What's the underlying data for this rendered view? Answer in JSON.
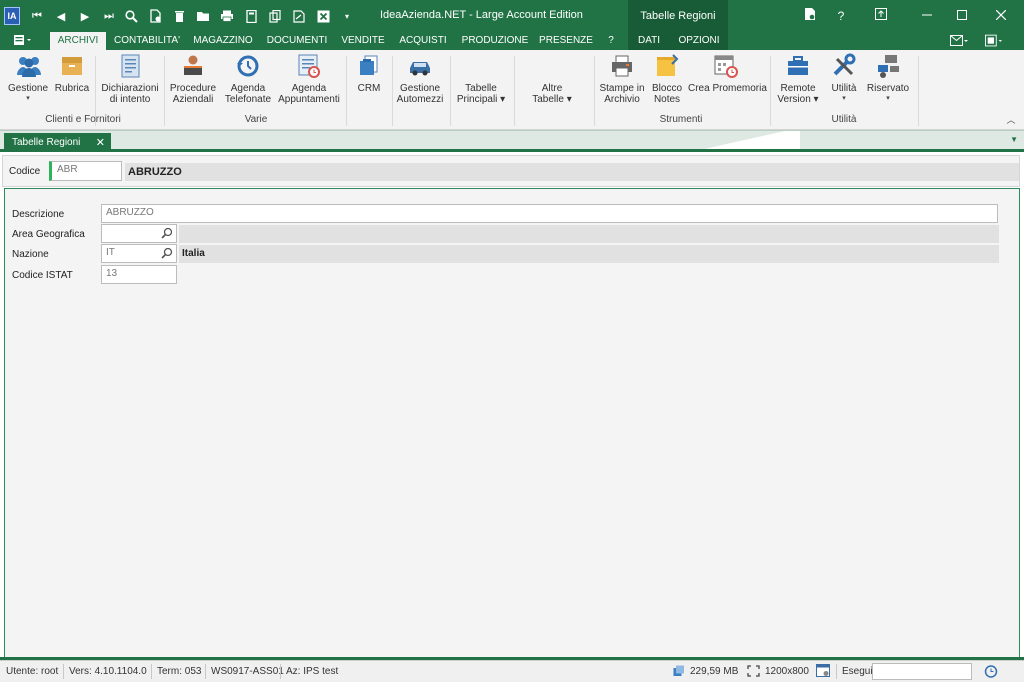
{
  "window": {
    "title": "IdeaAzienda.NET - Large Account Edition",
    "context_title": "Tabelle Regioni",
    "logo_text": "IA",
    "minimize_icon": "minimize-icon",
    "maximize_icon": "maximize-icon",
    "close_icon": "close-icon",
    "help_label": "?"
  },
  "ribbon_tabs": [
    {
      "label": "ARCHIVI",
      "active": true
    },
    {
      "label": "CONTABILITA'"
    },
    {
      "label": "MAGAZZINO"
    },
    {
      "label": "DOCUMENTI"
    },
    {
      "label": "VENDITE"
    },
    {
      "label": "ACQUISTI"
    },
    {
      "label": "PRODUZIONE"
    },
    {
      "label": "PRESENZE"
    },
    {
      "label": "?"
    },
    {
      "label": "DATI"
    },
    {
      "label": "OPZIONI"
    }
  ],
  "ribbon": {
    "buttons": [
      {
        "label": "Gestione",
        "caret": "▾"
      },
      {
        "label": "Rubrica"
      },
      {
        "label1": "Dichiarazioni",
        "label2": "di intento"
      },
      {
        "label1": "Procedure",
        "label2": "Aziendali"
      },
      {
        "label1": "Agenda",
        "label2": "Telefonate"
      },
      {
        "label1": "Agenda",
        "label2": "Appuntamenti"
      },
      {
        "label": "CRM"
      },
      {
        "label1": "Gestione",
        "label2": "Automezzi"
      },
      {
        "label1": "Tabelle",
        "label2": "Principali ▾"
      },
      {
        "label1": "Altre",
        "label2": "Tabelle ▾"
      },
      {
        "label1": "Stampe in",
        "label2": "Archivio"
      },
      {
        "label1": "Blocco",
        "label2": "Notes"
      },
      {
        "label": "Crea Promemoria"
      },
      {
        "label1": "Remote",
        "label2": "Version ▾"
      },
      {
        "label": "Utilità",
        "caret": "▾"
      },
      {
        "label": "Riservato",
        "caret": "▾"
      }
    ],
    "groups": [
      "Clienti e Fornitori",
      "Varie",
      "Strumenti",
      "Utilità"
    ]
  },
  "document_tab": {
    "label": "Tabelle Regioni",
    "close": "✕"
  },
  "record": {
    "codice_label": "Codice",
    "codice_value": "ABR",
    "codice_description": "ABRUZZO"
  },
  "form": {
    "descrizione": {
      "label": "Descrizione",
      "value": "ABRUZZO"
    },
    "area_geografica": {
      "label": "Area Geografica",
      "value": "",
      "description": ""
    },
    "nazione": {
      "label": "Nazione",
      "value": "IT",
      "description": "Italia"
    },
    "codice_istat": {
      "label": "Codice ISTAT",
      "value": "13"
    }
  },
  "status_bar": {
    "utente": "Utente: root",
    "versione": "Vers: 4.10.1104.0",
    "terminale": "Term: 053",
    "workstation": "WS0917-ASS01",
    "azienda": "Az: IPS test",
    "memoria": "229,59 MB",
    "risoluzione": "1200x800",
    "esegui_label": "Esegui"
  },
  "colors": {
    "accent": "#217346",
    "accent_dark": "#185c37",
    "field_highlight": "#2fb35a"
  }
}
